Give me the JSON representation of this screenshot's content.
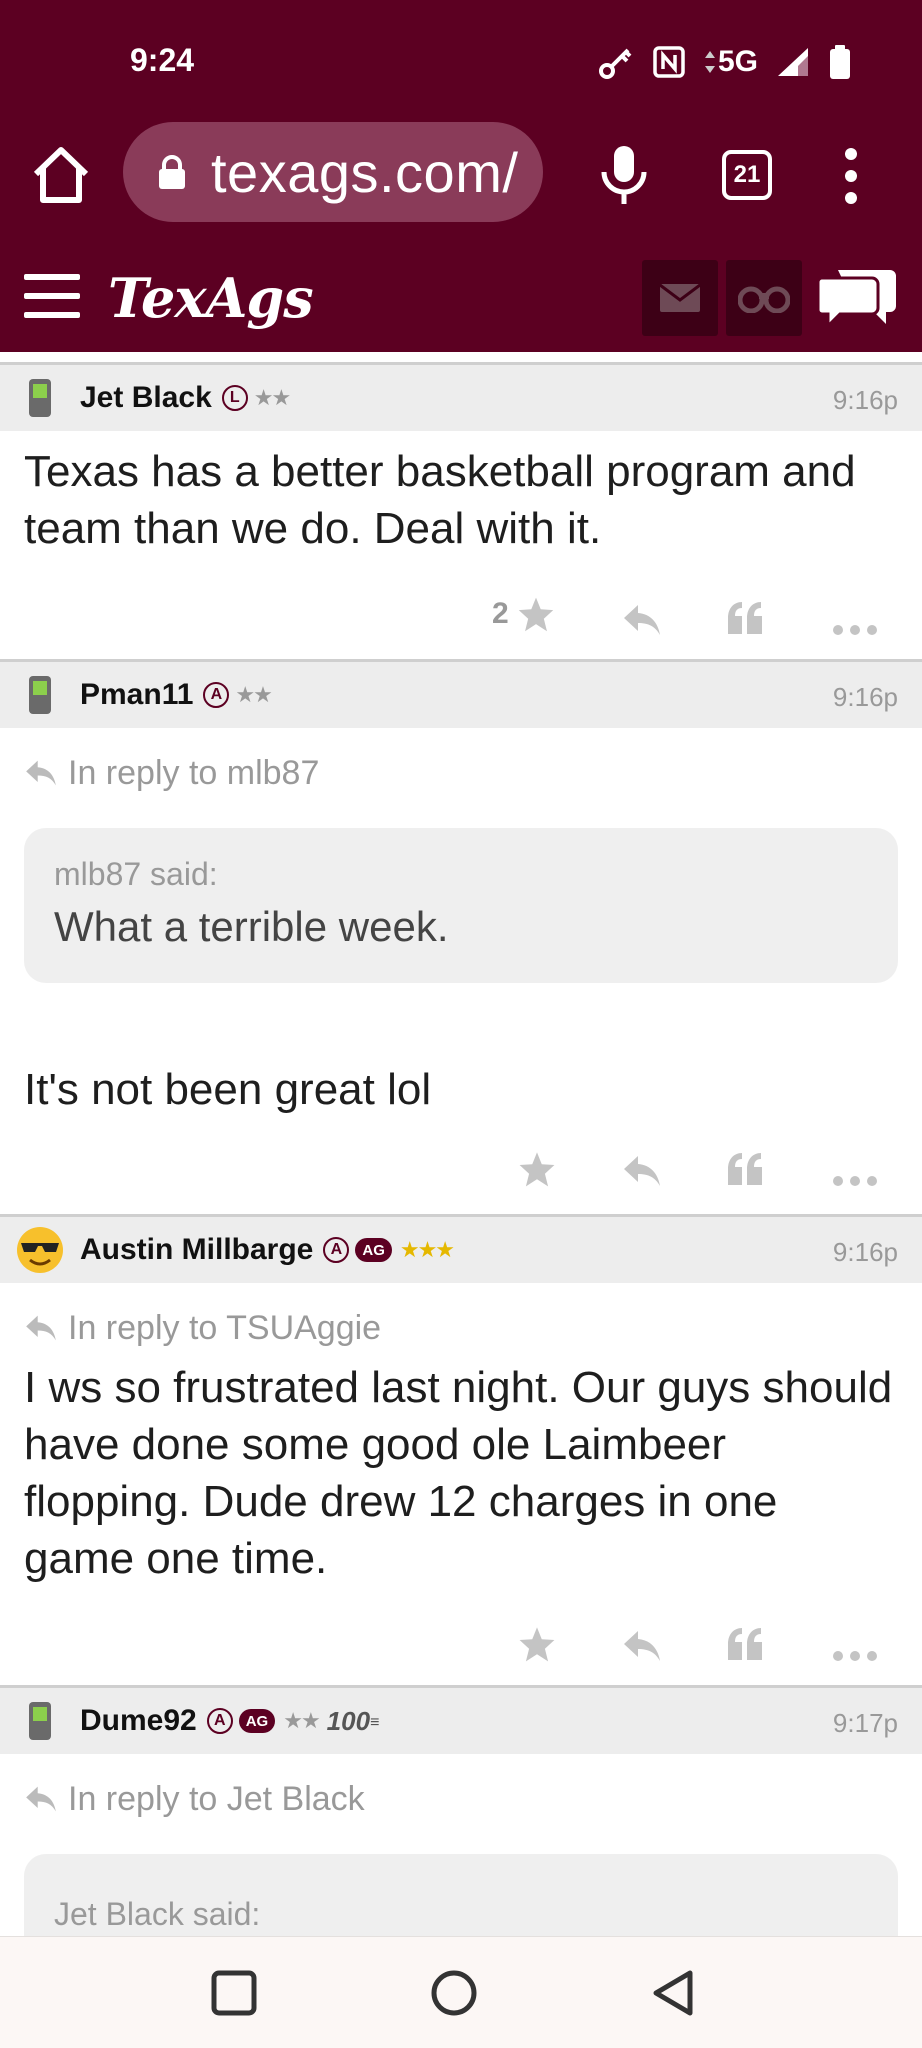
{
  "status_bar": {
    "time": "9:24",
    "network": "5G"
  },
  "browser": {
    "url": "texags.com/",
    "tab_count": "21"
  },
  "site": {
    "logo": "TexAgs"
  },
  "posts": [
    {
      "user": "Jet Black",
      "badge": "L",
      "ag": null,
      "stars": "★★",
      "extra": null,
      "time": "9:16p",
      "reply_to": null,
      "quote_said": null,
      "quote_text": null,
      "text": "Texas has a better basketball program and team than we do. Deal with it.",
      "likes": "2"
    },
    {
      "user": "Pman11",
      "badge": "A",
      "ag": null,
      "stars": "★★",
      "extra": null,
      "time": "9:16p",
      "reply_to": "In reply to mlb87",
      "quote_said": "mlb87 said:",
      "quote_text": "What a terrible week.",
      "text": "It's not been great lol",
      "likes": null
    },
    {
      "user": "Austin Millbarge",
      "badge": "A",
      "ag": "AG",
      "stars": "★★★",
      "extra": null,
      "time": "9:16p",
      "reply_to": "In reply to TSUAggie",
      "quote_said": null,
      "quote_text": null,
      "text": "I ws so frustrated last night. Our guys should have done some good ole Laimbeer flopping. Dude drew 12 charges in one game one time.",
      "likes": null
    },
    {
      "user": "Dume92",
      "badge": "A",
      "ag": "AG",
      "stars": "★★",
      "extra": "100",
      "time": "9:17p",
      "reply_to": "In reply to Jet Black",
      "quote_said": "Jet Black said:",
      "quote_text": null,
      "text": null,
      "likes": null
    }
  ],
  "colors": {
    "brand": "#5c0022",
    "url_pill": "#8a3b59",
    "muted": "#999999",
    "gold": "#e5b800"
  }
}
